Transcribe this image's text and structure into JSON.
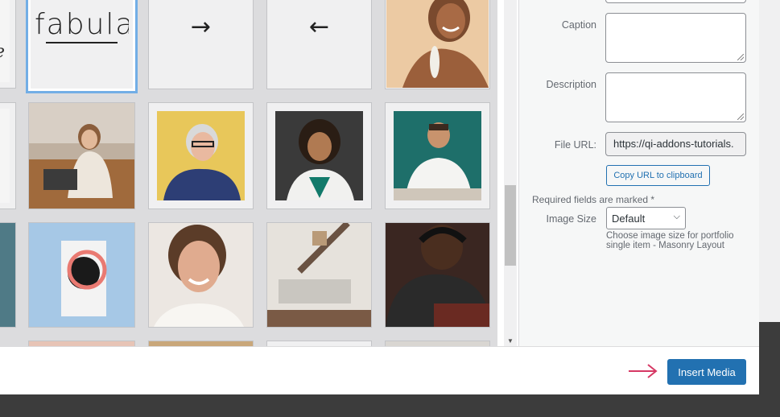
{
  "media_grid": {
    "row1": [
      {
        "name": "script-logo-partial",
        "text": "e"
      },
      {
        "name": "fabula-logo",
        "text": "fabula",
        "selected": true
      },
      {
        "name": "arrow-right",
        "glyph": "→"
      },
      {
        "name": "arrow-left",
        "glyph": "←"
      },
      {
        "name": "smiling-woman-photo"
      }
    ],
    "row2": [
      "partial-left-tile",
      "woman-laptop-sofa-photo",
      "woman-glasses-yellow-photo",
      "woman-phone-photo",
      "man-desk-photo"
    ],
    "row3": [
      "partial-left-tile",
      "book-cover-photo",
      "smiling-woman-portrait-photo",
      "living-room-photo",
      "man-headphones-photo"
    ]
  },
  "attachment_details": {
    "caption_label": "Caption",
    "caption_value": "",
    "description_label": "Description",
    "description_value": "",
    "file_url_label": "File URL:",
    "file_url_value": "https://qi-addons-tutorials.",
    "copy_url_button": "Copy URL to clipboard",
    "required_note": "Required fields are marked *",
    "image_size_label": "Image Size",
    "image_size_value": "Default",
    "image_size_help": "Choose image size for portfolio single item - Masonry Layout"
  },
  "toolbar": {
    "insert_button": "Insert Media"
  },
  "colors": {
    "primary": "#2271b1",
    "selection": "#72aee6",
    "annotation_arrow": "#d63864"
  }
}
